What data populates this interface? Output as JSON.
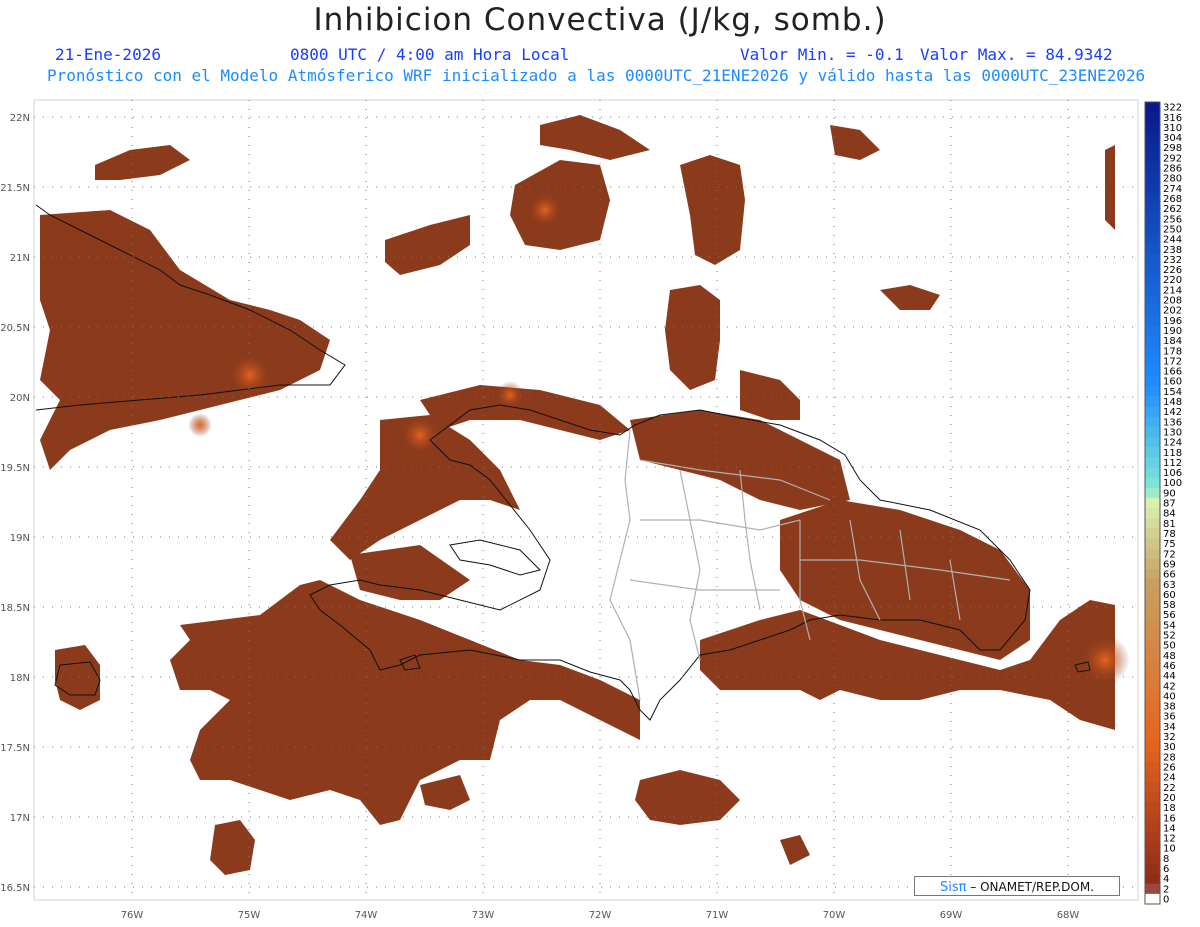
{
  "header": {
    "title": "Inhibicion Convectiva (J/kg, somb.)",
    "date": "21-Ene-2026",
    "time": "0800 UTC / 4:00 am Hora Local",
    "valor_min": "Valor Min. = -0.1",
    "valor_max": "Valor Max. = 84.9342",
    "model_line": "Pronóstico con el Modelo Atmósferico WRF inicializado a las 0000UTC_21ENE2026 y válido hasta las  0000UTC_23ENE2026"
  },
  "axes": {
    "latitude_ticks": [
      "22N",
      "21.5N",
      "21N",
      "20.5N",
      "20N",
      "19.5N",
      "19N",
      "18.5N",
      "18N",
      "17.5N",
      "17N",
      "16.5N"
    ],
    "longitude_ticks": [
      "76W",
      "75W",
      "74W",
      "73W",
      "72W",
      "71W",
      "70W",
      "69W",
      "68W"
    ]
  },
  "colorbar": {
    "labels": [
      "322",
      "316",
      "310",
      "304",
      "298",
      "292",
      "286",
      "280",
      "274",
      "268",
      "262",
      "256",
      "250",
      "244",
      "238",
      "232",
      "226",
      "220",
      "214",
      "208",
      "202",
      "196",
      "190",
      "184",
      "178",
      "172",
      "166",
      "160",
      "154",
      "148",
      "142",
      "136",
      "130",
      "124",
      "118",
      "112",
      "106",
      "100",
      "90",
      "87",
      "84",
      "81",
      "78",
      "75",
      "72",
      "69",
      "66",
      "63",
      "60",
      "58",
      "56",
      "54",
      "52",
      "50",
      "48",
      "46",
      "44",
      "42",
      "40",
      "38",
      "36",
      "34",
      "32",
      "30",
      "28",
      "26",
      "24",
      "22",
      "20",
      "18",
      "16",
      "14",
      "12",
      "10",
      "8",
      "6",
      "4",
      "2",
      "0"
    ],
    "colors": {
      "high": "#0a1a8c",
      "mid_blue": "#1e8cff",
      "cyan": "#7de8d8",
      "pale_green": "#d8f0b0",
      "tan": "#c8a060",
      "orange": "#e8641e",
      "dark_brown": "#8a2a18",
      "zero": "#ffffff"
    }
  },
  "field_colors": {
    "base": "#8b3a1c",
    "warm": "#b84a18",
    "hot": "#e8641e",
    "coast": "#111111",
    "border": "#b0b0b0"
  },
  "credit": {
    "brand": "Sisπ",
    "text": " – ONAMET/REP.DOM."
  }
}
